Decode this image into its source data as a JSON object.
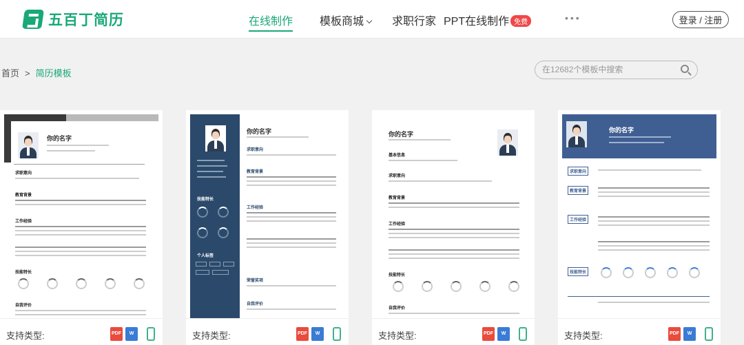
{
  "header": {
    "logo_text": "五百丁简历",
    "nav": [
      {
        "label": "在线制作",
        "active": true
      },
      {
        "label": "模板商城",
        "dropdown": true
      },
      {
        "label": "求职行家"
      },
      {
        "label": "PPT在线制作",
        "badge": "免费"
      }
    ],
    "more": "•••",
    "login": "登录 / 注册"
  },
  "breadcrumb": {
    "home": "首页",
    "sep": ">",
    "current": "简历模板"
  },
  "search": {
    "placeholder": "在12682个模板中搜索"
  },
  "cards": [
    {
      "support_label": "支持类型:",
      "formats": [
        "PDF",
        "word",
        "mobile"
      ]
    },
    {
      "support_label": "支持类型:",
      "formats": [
        "PDF",
        "word",
        "mobile"
      ]
    },
    {
      "support_label": "支持类型:",
      "formats": [
        "PDF",
        "word",
        "mobile"
      ]
    },
    {
      "support_label": "支持类型:",
      "formats": [
        "PDF",
        "word",
        "mobile"
      ]
    }
  ],
  "resume": {
    "name": "你的名字",
    "job_intent": "求职意向",
    "education": "教育背景",
    "work": "工作经验",
    "skills": "技能特长",
    "self_eval": "自我评价",
    "basic_info": "基本信息",
    "personal_tags": "个人标签",
    "awards": "荣誉奖项"
  },
  "colors": {
    "brand": "#1aa879",
    "navy": "#2b4a6b",
    "blue_header": "#3f5f93"
  }
}
